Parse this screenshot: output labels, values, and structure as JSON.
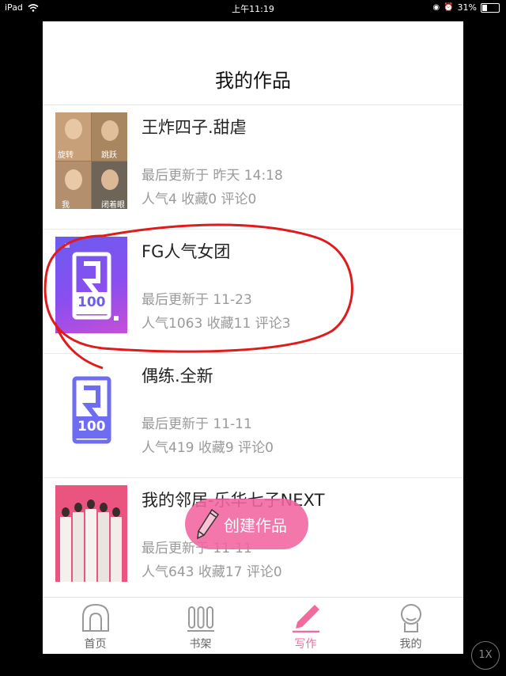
{
  "statusbar": {
    "device": "iPad",
    "time": "上午11:19",
    "battery": "31%"
  },
  "page": {
    "title": "我的作品"
  },
  "works": [
    {
      "name": "王炸四子.甜虐",
      "updated": "最后更新于 昨天 14:18",
      "stats": "人气4 收藏0 评论0",
      "cover_captions": [
        "旋转",
        "跳跃",
        "我",
        "闭着眼"
      ]
    },
    {
      "name": "FG人气女团",
      "updated": "最后更新于 11-23",
      "stats": "人气1063 收藏11 评论3",
      "cover_text": "100"
    },
    {
      "name": "偶练.全新",
      "updated": "最后更新于 11-11",
      "stats": "人气419 收藏9 评论0",
      "cover_text": "100"
    },
    {
      "name": "我的邻居-乐华七子NEXT",
      "updated": "最后更新于 11-11",
      "stats": "人气643 收藏17 评论0"
    }
  ],
  "fab": {
    "label": "创建作品",
    "icon": "pencil-icon"
  },
  "tabbar": [
    {
      "label": "首页",
      "icon": "home-arch-icon"
    },
    {
      "label": "书架",
      "icon": "bookshelf-icon"
    },
    {
      "label": "写作",
      "icon": "pen-icon",
      "active": true
    },
    {
      "label": "我的",
      "icon": "profile-icon"
    }
  ],
  "zoom_button": "1X",
  "colors": {
    "accent": "#f06a9e",
    "annotation": "#e01b1b",
    "cover_purple": "#6e6cf0"
  }
}
